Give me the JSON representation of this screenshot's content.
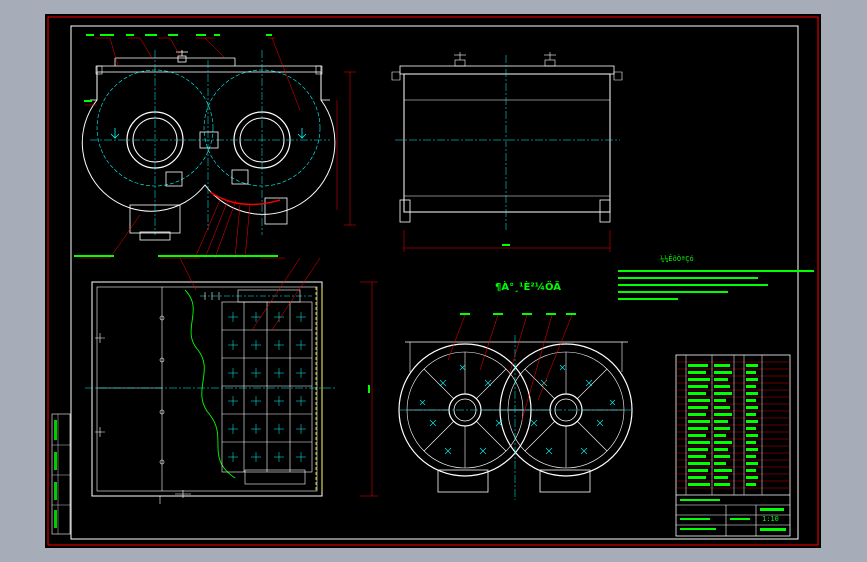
{
  "drawing": {
    "section_title": "¶À°¸¹È²¼ÖÃ",
    "tech_heading": "¼¼ÊõÒªÇó",
    "scale": "1:10",
    "colors": {
      "background": "#000000",
      "frame": "#ff0000",
      "outline": "#ffffff",
      "centerline": "#00ffff",
      "leader": "#ff0000",
      "text": "#00ff00",
      "hatch": "#00ff00",
      "dimension": "#ff0000"
    }
  }
}
